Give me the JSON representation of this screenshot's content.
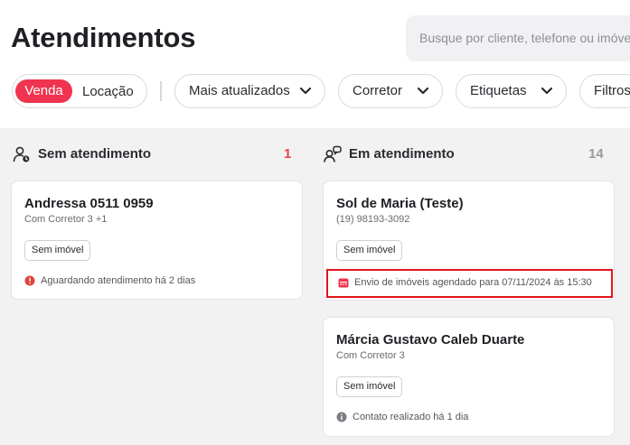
{
  "page": {
    "title": "Atendimentos"
  },
  "search": {
    "placeholder": "Busque por cliente, telefone ou imóvel"
  },
  "filters": {
    "segment": {
      "selected": "Venda",
      "other": "Locação"
    },
    "sort": "Mais atualizados",
    "broker": "Corretor",
    "tags": "Etiquetas",
    "more": "Filtros"
  },
  "columns": [
    {
      "title": "Sem atendimento",
      "count": "1",
      "count_color": "#e8434f",
      "cards": [
        {
          "name": "Andressa 0511 0959",
          "subtitle": "Com Corretor 3 +1",
          "tag": "Sem imóvel",
          "status": "Aguardando atendimento há 2 dias",
          "status_icon": "alert-icon",
          "status_color": "#e0433b"
        }
      ]
    },
    {
      "title": "Em atendimento",
      "count": "14",
      "count_color": "#9a9ba1",
      "cards": [
        {
          "name": "Sol de Maria (Teste)",
          "subtitle": "(19) 98193-3092",
          "tag": "Sem imóvel",
          "status": "Envio de imóveis agendado para 07/11/2024 às 15:30",
          "status_icon": "calendar-icon",
          "status_color": "#f0344f"
        },
        {
          "name": "Márcia Gustavo Caleb Duarte",
          "subtitle": "Com Corretor 3",
          "tag": "Sem imóvel",
          "status": "Contato realizado há 1 dia",
          "status_icon": "info-icon",
          "status_color": "#7c7d83"
        }
      ]
    }
  ],
  "colors": {
    "accent": "#f0344f",
    "highlight": "#e3141c",
    "board_bg": "#f2f2f2"
  }
}
